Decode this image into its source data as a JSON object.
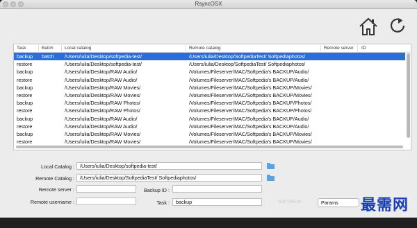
{
  "window": {
    "title": "RsyncOSX"
  },
  "toolbar": {
    "home_icon": "home-icon",
    "refresh_icon": "refresh-icon"
  },
  "table": {
    "columns": [
      "Task",
      "Batch",
      "Local catalog",
      "Remote catalog",
      "Remote server",
      "ID"
    ],
    "rows": [
      {
        "task": "backup",
        "batch": "batch",
        "local": "/Users/iulia/Desktop/softpedia-test/",
        "remote": "/Users/iulia/Desktop/SoftpediaTest/ Softpediaphotos/",
        "server": "",
        "id": "",
        "selected": true
      },
      {
        "task": "restore",
        "batch": "",
        "local": "/Users/iulia/Desktop/softpedia-test/",
        "remote": "/Users/iulia/Desktop/SoftpediaTest/ Softpediaphotos/",
        "server": "",
        "id": "",
        "selected": false
      },
      {
        "task": "backup",
        "batch": "",
        "local": "/Users/iulia/Desktop/RAW Audio/",
        "remote": "/Volumes/Fileserver/MAC/Softpedia's BACKUP/Audio/",
        "server": "",
        "id": "",
        "selected": false
      },
      {
        "task": "restore",
        "batch": "",
        "local": "/Users/iulia/Desktop/RAW Audio/",
        "remote": "/Volumes/Fileserver/MAC/Softpedia's BACKUP/Audio/",
        "server": "",
        "id": "",
        "selected": false
      },
      {
        "task": "backup",
        "batch": "",
        "local": "/Users/iulia/Desktop/RAW Movies/",
        "remote": "/Volumes/Fileserver/MAC/Softpedia's BACKUP/Movies/",
        "server": "",
        "id": "",
        "selected": false
      },
      {
        "task": "restore",
        "batch": "",
        "local": "/Users/iulia/Desktop/RAW Movies/",
        "remote": "/Volumes/Fileserver/MAC/Softpedia's BACKUP/Movies/",
        "server": "",
        "id": "",
        "selected": false
      },
      {
        "task": "backup",
        "batch": "",
        "local": "/Users/iulia/Desktop/RAW Photos/",
        "remote": "/Volumes/Fileserver/MAC/Softpedia's BACKUP/Photos/",
        "server": "",
        "id": "",
        "selected": false
      },
      {
        "task": "restore",
        "batch": "",
        "local": "/Users/iulia/Desktop/RAW Photos/",
        "remote": "/Volumes/Fileserver/MAC/Softpedia's BACKUP/Photos/",
        "server": "",
        "id": "",
        "selected": false
      },
      {
        "task": "backup",
        "batch": "",
        "local": "/Users/iulia/Desktop/RAW Audio/",
        "remote": "/Volumes/Fileserver/MAC/Softpedia's BACKUP/Audio/",
        "server": "",
        "id": "",
        "selected": false
      },
      {
        "task": "restore",
        "batch": "",
        "local": "/Users/iulia/Desktop/RAW Audio/",
        "remote": "/Volumes/Fileserver/MAC/Softpedia's BACKUP/Audio/",
        "server": "",
        "id": "",
        "selected": false
      },
      {
        "task": "backup",
        "batch": "",
        "local": "/Users/iulia/Desktop/RAW Movies/",
        "remote": "/Volumes/Fileserver/MAC/Softpedia's BACKUP/Movies/",
        "server": "",
        "id": "",
        "selected": false
      },
      {
        "task": "restore",
        "batch": "",
        "local": "/Users/iulia/Desktop/RAW Movies/",
        "remote": "/Volumes/Fileserver/MAC/Softpedia's BACKUP/Movies/",
        "server": "",
        "id": "",
        "selected": false
      }
    ]
  },
  "form": {
    "local_catalog_label": "Local Catalog :",
    "local_catalog_value": "/Users/iulia/Desktop/softpedia-test/",
    "remote_catalog_label": "Remote Catalog :",
    "remote_catalog_value": "/Users/iulia/Desktop/SoftpediaTest/ Softpediaphotos/",
    "remote_server_label": "Remote server :",
    "remote_server_value": "",
    "backup_id_label": "Backup ID :",
    "backup_id_value": "",
    "remote_username_label": "Remote username :",
    "remote_username_value": "",
    "task_label": "Task :",
    "task_value": "backup",
    "params_button": "Params"
  },
  "watermarks": {
    "softpedia": "SOFTPEDIA",
    "site_logo": "最需网"
  },
  "colors": {
    "selection": "#2b6ed8",
    "folder_icon": "#5aa3e3",
    "site_logo": "#1a3fb5"
  }
}
